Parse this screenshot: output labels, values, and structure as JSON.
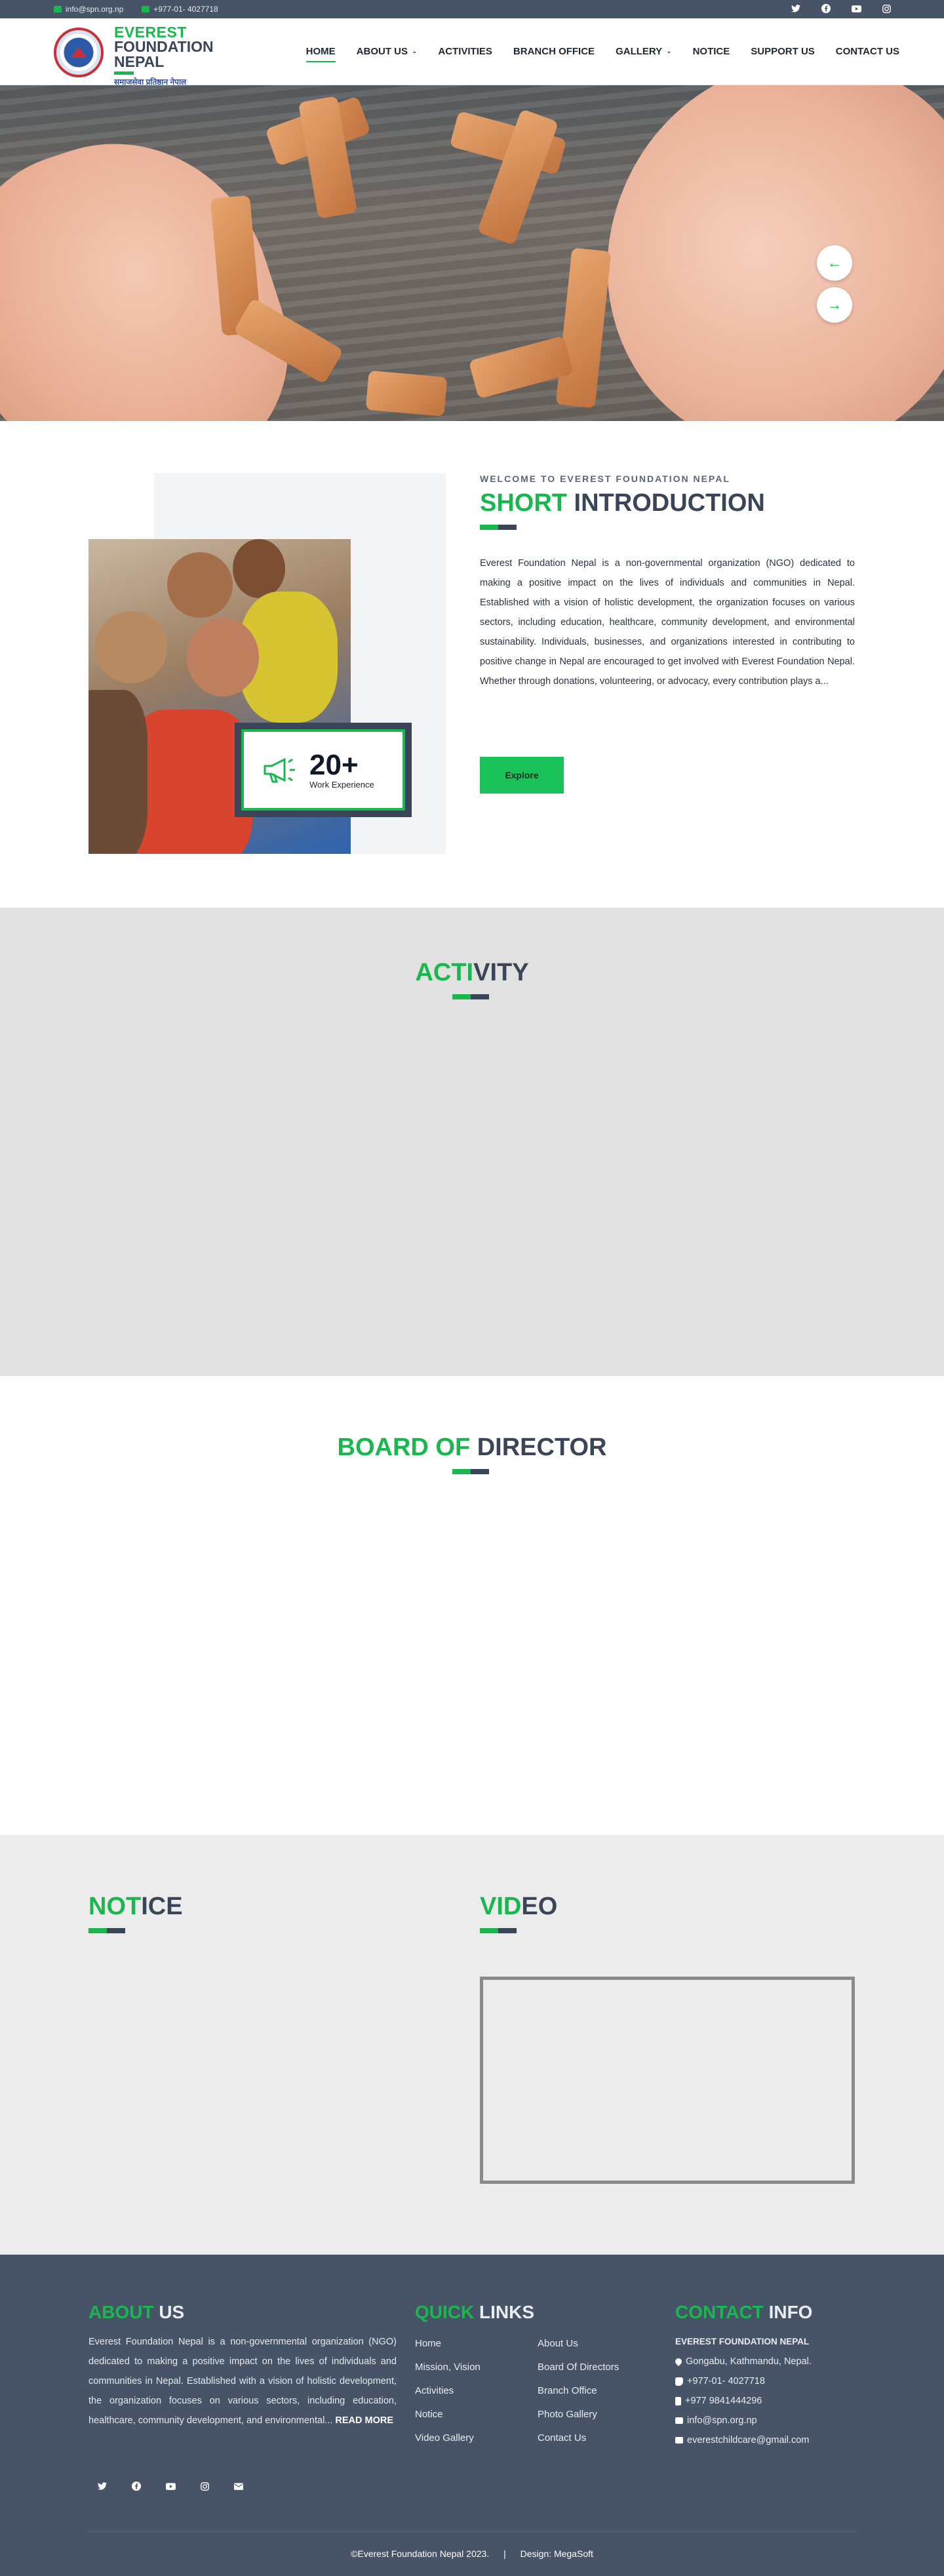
{
  "topbar": {
    "email": "info@spn.org.np",
    "phone": "+977-01- 4027718",
    "social": [
      "twitter-icon",
      "facebook-icon",
      "youtube-icon",
      "instagram-icon"
    ]
  },
  "logo": {
    "line1": "EVEREST",
    "line2": "FOUNDATION",
    "line3": "NEPAL",
    "tagline": "समाजसेवा प्रतिष्ठान नेपाल"
  },
  "nav": {
    "items": [
      {
        "label": "HOME",
        "active": true,
        "dropdown": false
      },
      {
        "label": "ABOUT US",
        "active": false,
        "dropdown": true
      },
      {
        "label": "ACTIVITIES",
        "active": false,
        "dropdown": false
      },
      {
        "label": "BRANCH OFFICE",
        "active": false,
        "dropdown": false
      },
      {
        "label": "GALLERY",
        "active": false,
        "dropdown": true
      },
      {
        "label": "NOTICE",
        "active": false,
        "dropdown": false
      },
      {
        "label": "SUPPORT US",
        "active": false,
        "dropdown": false
      },
      {
        "label": "CONTACT US",
        "active": false,
        "dropdown": false
      }
    ]
  },
  "hero": {
    "prev_label": "←",
    "next_label": "→"
  },
  "intro": {
    "eyebrow": "WELCOME TO EVEREST FOUNDATION NEPAL",
    "title_green": "SHORT",
    "title_dark": " INTRODUCTION",
    "paragraph": "Everest Foundation Nepal is a non-governmental organization (NGO) dedicated to making a positive impact on the lives of individuals and communities in Nepal. Established with a vision of holistic development, the organization focuses on various sectors, including education, healthcare, community development, and environmental sustainability. Individuals, businesses, and organizations interested in contributing to positive change in Nepal are encouraged to get involved with Everest Foundation Nepal. Whether through donations, volunteering, or advocacy, every contribution plays a...",
    "button": "Explore",
    "experience_number": "20+",
    "experience_label": "Work Experience"
  },
  "activity": {
    "title_green": "ACTI",
    "title_dark": "VITY"
  },
  "board": {
    "title_green": "BOARD OF",
    "title_dark": " DIRECTOR"
  },
  "notice": {
    "title_green": "NOT",
    "title_dark": "ICE"
  },
  "video": {
    "title_green": "VID",
    "title_dark": "EO"
  },
  "footer": {
    "about_title_green": "ABOUT",
    "about_title_white": " US",
    "about_text": "Everest Foundation Nepal is a non-governmental organization (NGO) dedicated to making a positive impact on the lives of individuals and communities in Nepal. Established with a vision of holistic development, the organization focuses on various sectors, including education, healthcare, community development, and environmental...",
    "read_more": "READ MORE",
    "links_title_green": "QUICK",
    "links_title_white": " LINKS",
    "links_col1": [
      "Home",
      "Mission, Vision",
      "Activities",
      "Notice",
      "Video Gallery"
    ],
    "links_col2": [
      "About Us",
      "Board Of Directors",
      "Branch Office",
      "Photo Gallery",
      "Contact Us"
    ],
    "contact_title_green": "CONTACT",
    "contact_title_white": " INFO",
    "org_name": "EVEREST FOUNDATION NEPAL",
    "address": "Gongabu, Kathmandu, Nepal.",
    "phone1": "+977-01- 4027718",
    "phone2": "+977 9841444296",
    "email1": "info@spn.org.np",
    "email2": "everestchildcare@gmail.com",
    "social": [
      "twitter-icon",
      "facebook-icon",
      "youtube-icon",
      "instagram-icon",
      "mail-icon"
    ],
    "copyright": "©Everest Foundation Nepal 2023.",
    "separator": "|",
    "design": "Design: MegaSoft"
  },
  "colors": {
    "accent_green": "#19b84f",
    "navy": "#3a4558",
    "topbar": "#475366",
    "footer": "#475366"
  }
}
